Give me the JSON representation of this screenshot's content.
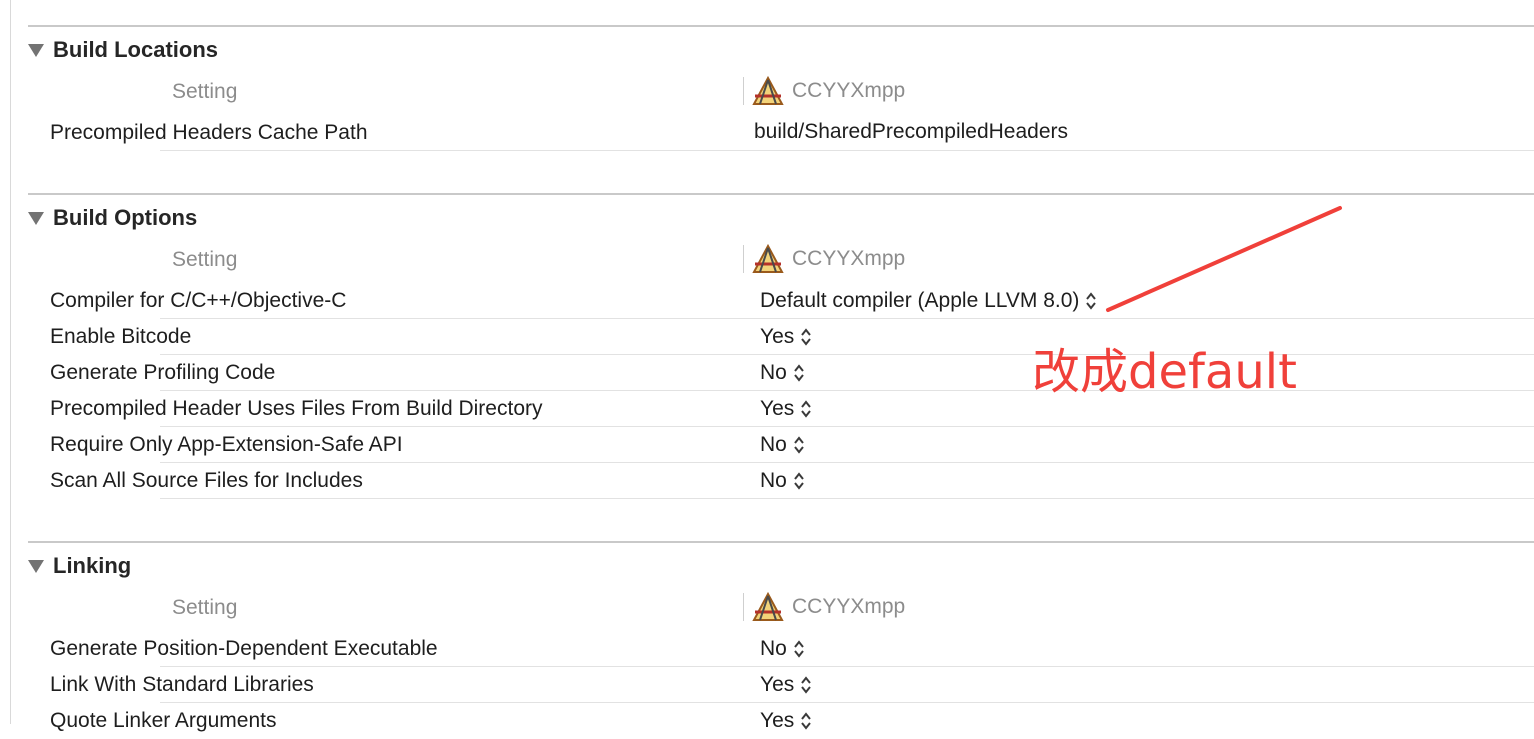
{
  "sections": [
    {
      "title": "Build Locations",
      "column_setting": "Setting",
      "target_name": "CCYYXmpp",
      "rows": [
        {
          "name": "Precompiled Headers Cache Path",
          "value": "build/SharedPrecompiledHeaders"
        }
      ]
    },
    {
      "title": "Build Options",
      "column_setting": "Setting",
      "target_name": "CCYYXmpp",
      "rows": [
        {
          "name": "Compiler for C/C++/Objective-C",
          "value": "Default compiler (Apple LLVM 8.0)"
        },
        {
          "name": "Enable Bitcode",
          "value": "Yes"
        },
        {
          "name": "Generate Profiling Code",
          "value": "No"
        },
        {
          "name": "Precompiled Header Uses Files From Build Directory",
          "value": "Yes"
        },
        {
          "name": "Require Only App-Extension-Safe API",
          "value": "No"
        },
        {
          "name": "Scan All Source Files for Includes",
          "value": "No"
        }
      ]
    },
    {
      "title": "Linking",
      "column_setting": "Setting",
      "target_name": "CCYYXmpp",
      "rows": [
        {
          "name": "Generate Position-Dependent Executable",
          "value": "No"
        },
        {
          "name": "Link With Standard Libraries",
          "value": "Yes"
        },
        {
          "name": "Quote Linker Arguments",
          "value": "Yes"
        }
      ]
    }
  ],
  "annotation": {
    "text": "改成default",
    "color": "#f0403a"
  },
  "icons": {
    "target": "xcode-app-icon",
    "stepper": "stepper-updown-icon",
    "disclosure": "disclosure-triangle-icon"
  }
}
